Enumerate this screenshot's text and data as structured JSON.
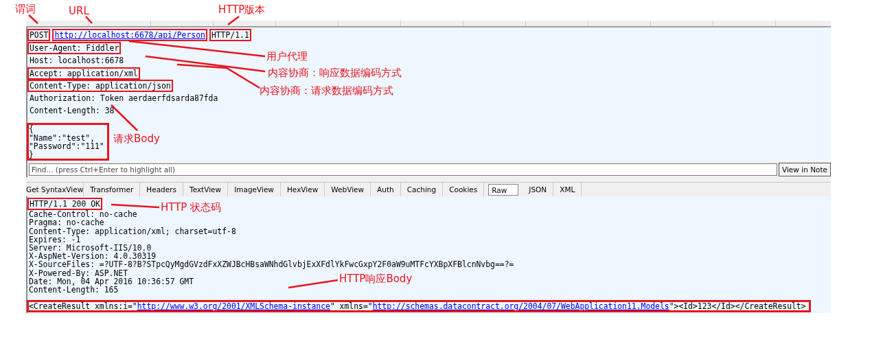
{
  "request": {
    "request_line": {
      "method": {
        "text": "POST",
        "marked": true
      },
      "url": {
        "text": "http://localhost:6678/api/Person",
        "marked": true
      },
      "version": {
        "text": "HTTP/1.1",
        "marked": true
      }
    },
    "headers": [
      {
        "text": "User-Agent: Fiddler",
        "marked": true
      },
      {
        "text": "Host: localhost:6678",
        "marked": false
      },
      {
        "text": "Accept: application/xml",
        "marked": true
      },
      {
        "text": "Content-Type: application/json",
        "marked": true
      },
      {
        "text": "Authorization: Token aerdaerfdsarda87fda",
        "marked": false
      },
      {
        "text": "Content-Length: 38",
        "marked": false
      }
    ],
    "body": {
      "marked": true,
      "lines": [
        "{",
        "\"Name\":\"test\",",
        "\"Password\":\"111\"",
        "}"
      ]
    }
  },
  "find_bar": {
    "placeholder": "Find... (press Ctrl+Enter to highlight all)",
    "button": "View in Note"
  },
  "tabs": [
    {
      "label": "Get SyntaxView",
      "selected": false
    },
    {
      "label": "Transformer",
      "selected": false
    },
    {
      "label": "Headers",
      "selected": false
    },
    {
      "label": "TextView",
      "selected": false
    },
    {
      "label": "ImageView",
      "selected": false
    },
    {
      "label": "HexView",
      "selected": false
    },
    {
      "label": "WebView",
      "selected": false
    },
    {
      "label": "Auth",
      "selected": false
    },
    {
      "label": "Caching",
      "selected": false
    },
    {
      "label": "Cookies",
      "selected": false
    },
    {
      "label": "Raw",
      "selected": true
    },
    {
      "label": "JSON",
      "selected": false
    },
    {
      "label": "XML",
      "selected": false
    }
  ],
  "response": {
    "status_line": {
      "text": "HTTP/1.1 200 OK",
      "marked": true
    },
    "headers": [
      "Cache-Control: no-cache",
      "Pragma: no-cache",
      "Content-Type: application/xml; charset=utf-8",
      "Expires: -1",
      "Server: Microsoft-IIS/10.0",
      "X-AspNet-Version: 4.0.30319",
      "X-SourceFiles: =?UTF-8?B?STpcQyMgdGVzdFxXZWJBcHBsaWNhdGlvbjExXFdlYkFwcGxpY2F0aW9uMTFcYXBpXFBlcnNvbg==?=",
      "X-Powered-By: ASP.NET",
      "Date: Mon, 04 Apr 2016 10:36:57 GMT",
      "Content-Length: 165"
    ],
    "body": {
      "marked": true,
      "segments": [
        {
          "kind": "text",
          "text": "<CreateResult xmlns:i=\""
        },
        {
          "kind": "link",
          "text": "http://www.w3.org/2001/XMLSchema-instance"
        },
        {
          "kind": "text",
          "text": "\" xmlns=\""
        },
        {
          "kind": "link",
          "text": "http://schemas.datacontract.org/2004/07/WebApplication11.Models"
        },
        {
          "kind": "text",
          "text": "\"><Id>123</Id></CreateResult>"
        }
      ]
    }
  },
  "annotations": [
    "谓词",
    "URL",
    "HTTP版本",
    "用户代理",
    "内容协商：响应数据编码方式",
    "内容协商：请求数据编码方式",
    "请求Body",
    "HTTP 状态码",
    "HTTP响应Body"
  ]
}
